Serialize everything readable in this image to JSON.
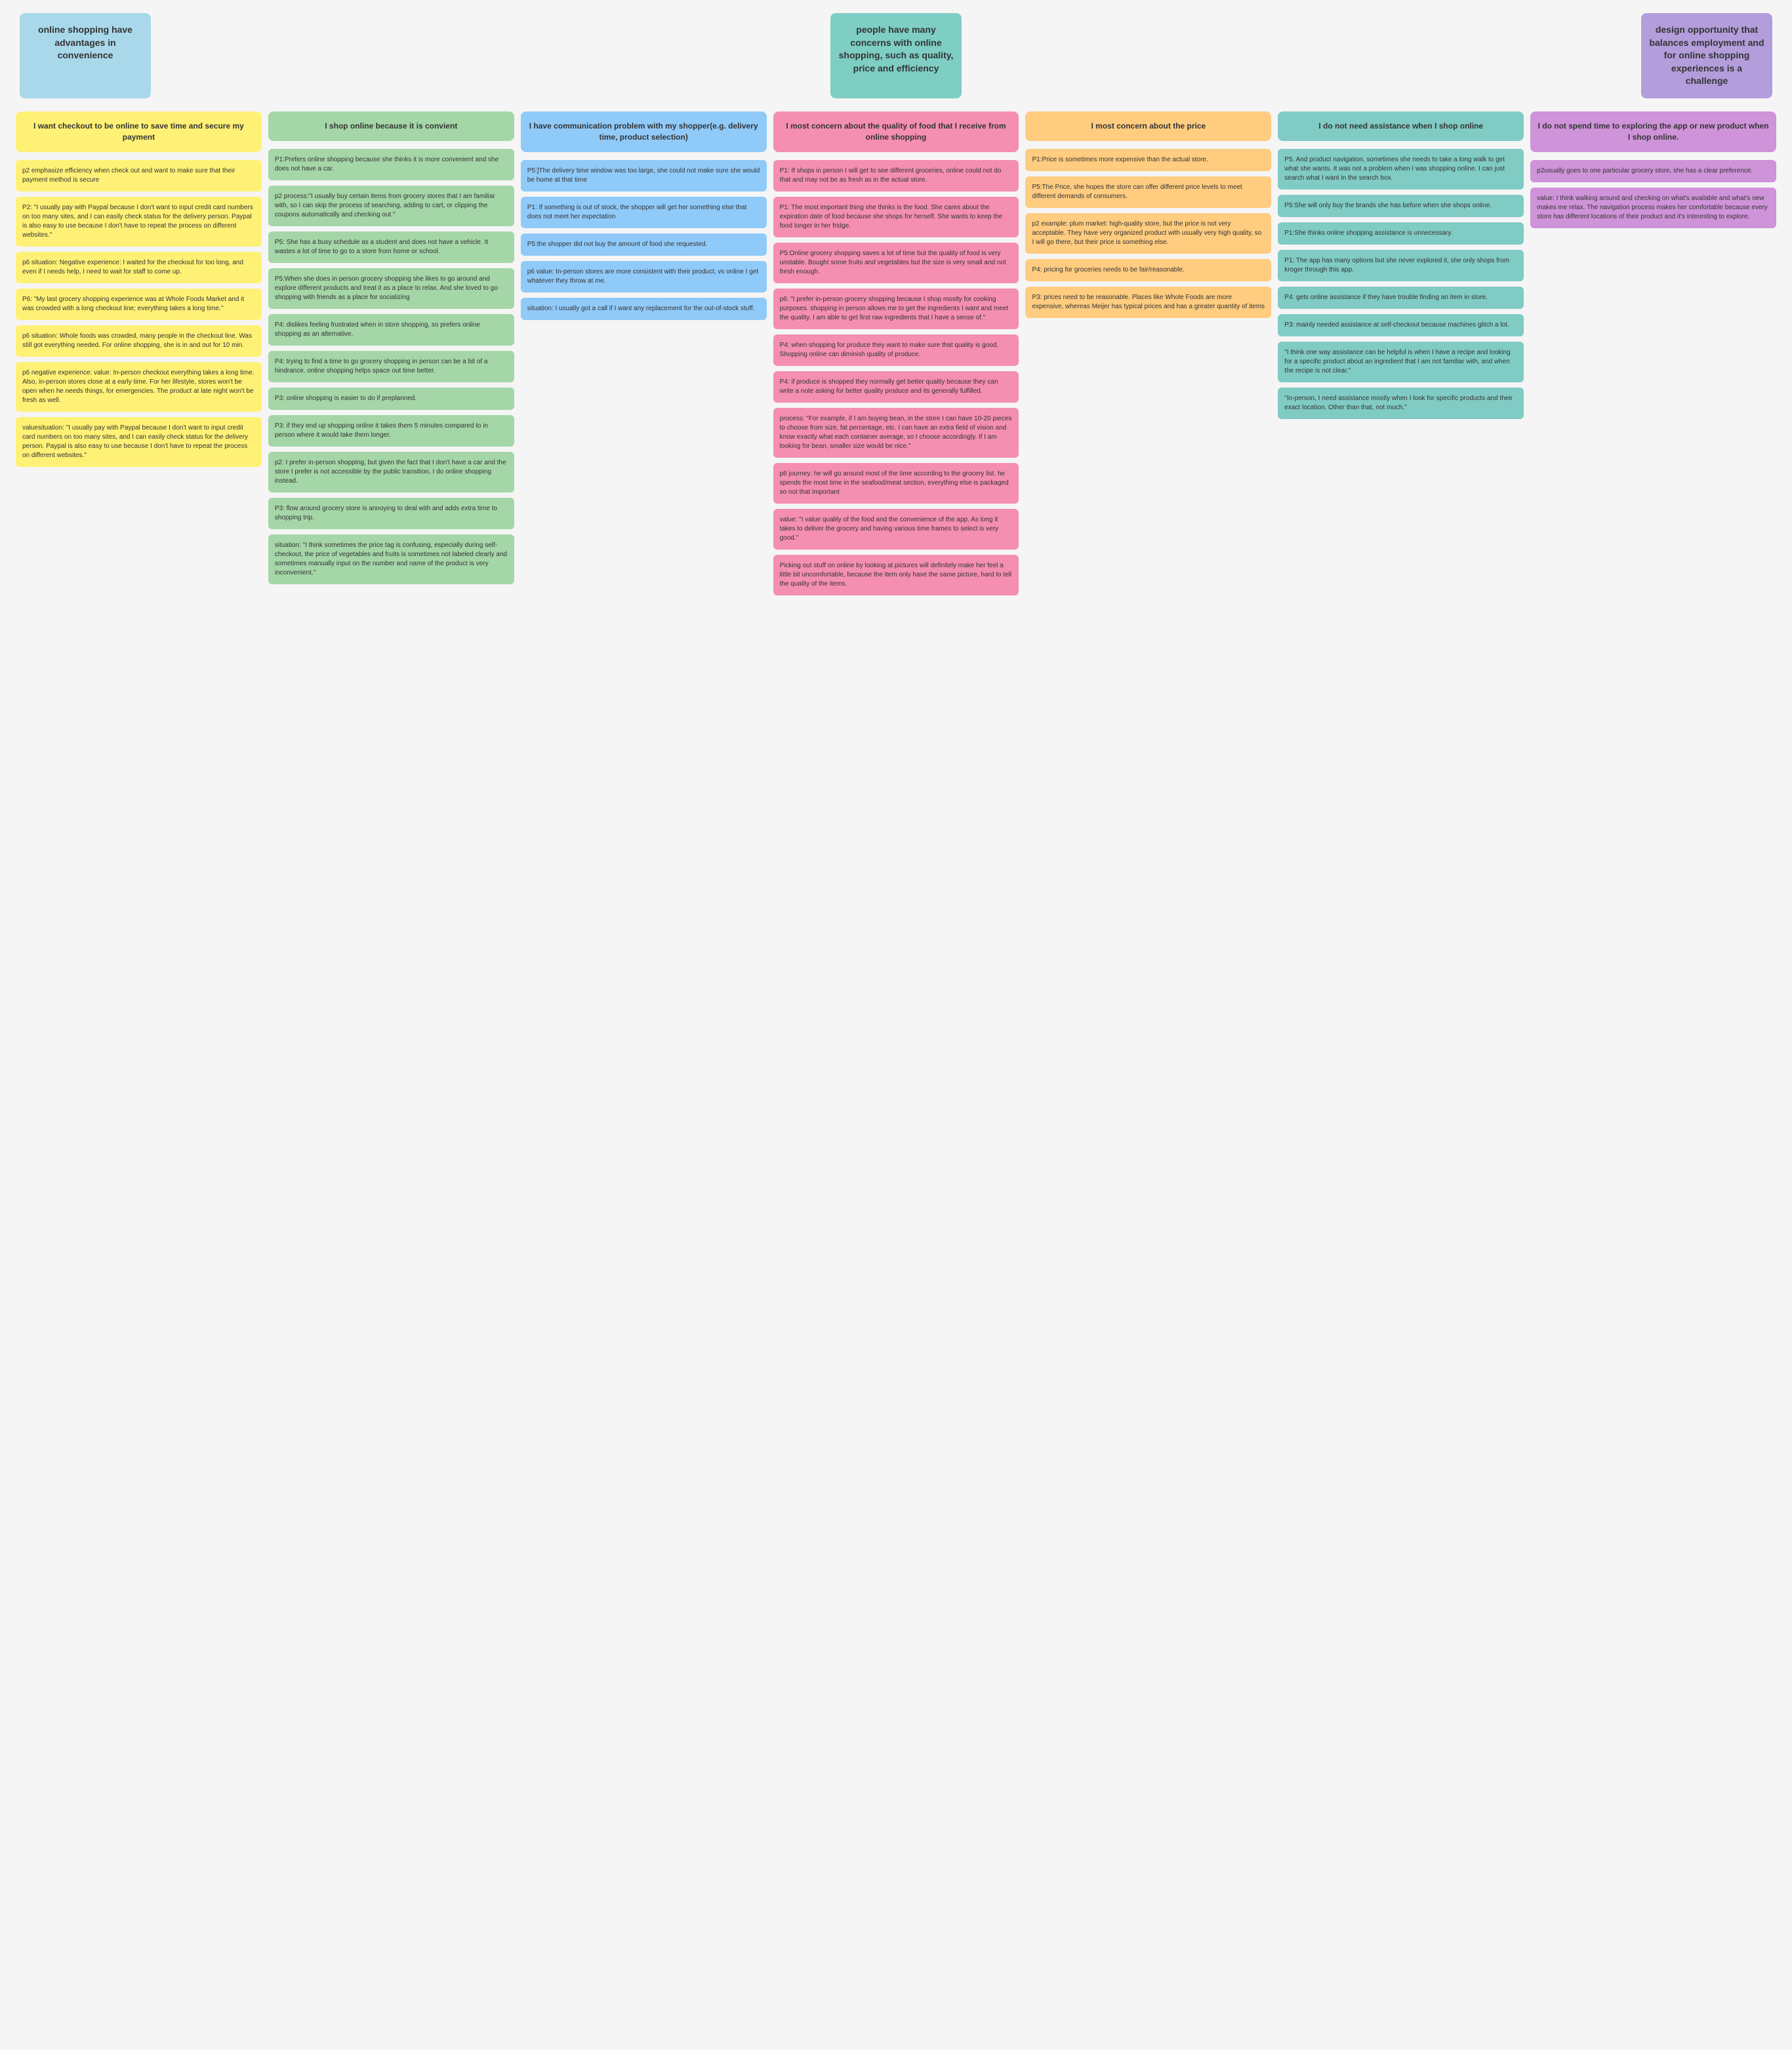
{
  "headers": [
    {
      "id": "h1",
      "text": "online shopping have advantages in convenience",
      "color": "header-blue"
    },
    {
      "id": "h2",
      "text": "people have many concerns with online shopping, such as quality, price and efficiency",
      "color": "header-teal"
    },
    {
      "id": "h3",
      "text": "design opportunity that balances employment and for online shopping experiences is a challenge",
      "color": "header-purple"
    }
  ],
  "columns": [
    {
      "id": "col1",
      "header": {
        "text": "I want checkout to be online to save time and secure my payment",
        "color": "col-header-yellow"
      },
      "notes": [
        {
          "text": "p2 emphasize efficiency when check out and want to make sure that their payment method is secure",
          "color": "note-yellow"
        },
        {
          "text": "P2: \"I usually pay with Paypal because I don't want to input credit card numbers on too many sites, and I can easily check status for the delivery person. Paypal is also easy to use because I don't have to repeat the process on different websites.\"",
          "color": "note-yellow"
        },
        {
          "text": "p6 situation: Negative experience: I waited for the checkout for too long, and even if I needs help, I need to wait for staff to come up.",
          "color": "note-yellow"
        },
        {
          "text": "P6: \"My last grocery shopping experience was at Whole Foods Market and it was crowded with a long checkout line; everything takes a long time.\"",
          "color": "note-yellow"
        },
        {
          "text": "p6 situation: Whole foods was crowded, many people in the checkout line. Was still got everything needed. For online shopping, she is in and out for 10 min.",
          "color": "note-yellow"
        },
        {
          "text": "p6 negative experience: value: In-person checkout everything takes a long time. Also, in-person stores close at a early time. For her lifestyle, stores won't be open when he needs things, for emergencies. The product at late night won't be fresh as well.",
          "color": "note-yellow"
        },
        {
          "text": "valuesituation: \"I usually pay with Paypal because I don't want to input credit card numbers on too many sites, and I can easily check status for the delivery person. Paypal is also easy to use because I don't have to repeat the process on different websites.\"",
          "color": "note-yellow"
        }
      ]
    },
    {
      "id": "col2",
      "header": {
        "text": "I shop online because it is convient",
        "color": "col-header-green"
      },
      "notes": [
        {
          "text": "P1:Prefers online shopping because she thinks it is more convenient and she does not have a car.",
          "color": "note-green"
        },
        {
          "text": "p2 process:\"I usually buy certain items from grocery stores that I am familiar with, so I can skip the process of searching, adding to cart, or clipping the coupons automatically and checking out.\"",
          "color": "note-green"
        },
        {
          "text": "P5: She has a busy schedule as a student and does not have a vehicle. It wastes a lot of time to go to a store from home or school.",
          "color": "note-green"
        },
        {
          "text": "P5:When she does in person grocery shopping she likes to go around and explore different products and treat it as a place to relax. And she loved to go shopping with friends as a place for socializing",
          "color": "note-green"
        },
        {
          "text": "P4: dislikes feeling frustrated when in store shopping, so prefers online shopping as an alternative.",
          "color": "note-green"
        },
        {
          "text": "P4: trying to find a time to go grocery shopping in person can be a bit of a hindrance. online shopping helps space out time better.",
          "color": "note-green"
        },
        {
          "text": "P3: online shopping is easier to do if preplanned.",
          "color": "note-green"
        },
        {
          "text": "P3: if they end up shopping online it takes them 5 minutes compared to in person where it would take them longer.",
          "color": "note-green"
        },
        {
          "text": "p2: I prefer in-person shopping, but given the fact that I don't have a car and the store I prefer is not accessible by the public transition, I do online shopping instead.",
          "color": "note-green"
        },
        {
          "text": "P3: flow around grocery store is annoying to deal with and adds extra time to shopping trip.",
          "color": "note-green"
        },
        {
          "text": "situation: \"I think sometimes the price tag is confusing, especially during self-checkout, the price of vegetables and fruits is sometimes not labeled clearly and sometimes manually input on the number and name of the product is very inconvenient.\"",
          "color": "note-green"
        }
      ]
    },
    {
      "id": "col3",
      "header": {
        "text": "I have communication problem with my shopper(e.g. delivery time, product selection)",
        "color": "col-header-blue"
      },
      "notes": [
        {
          "text": "P5:]The delivery time window was too large, she could not make sure she would be home at that time",
          "color": "note-blue"
        },
        {
          "text": "P1: If something is out of stock, the shopper will get her something else that does not meet her expectation",
          "color": "note-blue"
        },
        {
          "text": "P5:the shopper did not buy the amount of food she requested.",
          "color": "note-blue"
        },
        {
          "text": "p6 value: In-person stores are more consistent with their product, vs online I get whatever they throw at me.",
          "color": "note-blue"
        },
        {
          "text": "situation: I usually got a call if I want any replacement for the out-of-stock stuff.",
          "color": "note-blue"
        }
      ]
    },
    {
      "id": "col4",
      "header": {
        "text": "I most concern about the quality of food that I receive from online shopping",
        "color": "col-header-pink"
      },
      "notes": [
        {
          "text": "P1: If shops in person I will get to see different groceries, online could not do that and may not be as fresh as in the actual store.",
          "color": "note-pink"
        },
        {
          "text": "P1: The most important thing she thinks is the food. She cares about the expiration date of food because she shops for herself. She wants to keep the food longer in her fridge.",
          "color": "note-pink"
        },
        {
          "text": "P5:Online grocery shopping saves a lot of time but the quality of food is very unstable. Bought some fruits and vegetables but the size is very small and not fresh enough.",
          "color": "note-pink"
        },
        {
          "text": "p6: \"I prefer in-person grocery shopping because I shop mostly for cooking purposes. shopping in person allows me to get the ingredients I want and meet the quality. I am able to get first raw ingredients that I have a sense of.\"",
          "color": "note-pink"
        },
        {
          "text": "P4: when shopping for produce they want to make sure that quality is good. Shopping online can diminish quality of produce.",
          "color": "note-pink"
        },
        {
          "text": "P4: if produce is shopped they normally get better quality because they can write a note asking for better quality produce and its generally fulfilled.",
          "color": "note-pink"
        },
        {
          "text": "process: \"For example, if I am buying bean, in the store I can have 10-20 pieces to choose from size, fat percentage, etc. I can have an extra field of vision and know exactly what each container average, so I choose accordingly. If I am looking for bean, smaller size would be nice.\"",
          "color": "note-pink"
        },
        {
          "text": "p6 journey: he will go around most of the time according to the grocery list. he spends the most time in the seafood/meat section, everything else is packaged so not that important",
          "color": "note-pink"
        },
        {
          "text": "value: \"I value quality of the food and the convenience of the app. As long it takes to deliver the grocery and having various time frames to select is very good.\"",
          "color": "note-pink"
        },
        {
          "text": "Picking out stuff on online by looking at pictures will definitely make her feel a little bit uncomfortable, because the item only have the same picture, hard to tell the quality of the items.",
          "color": "note-pink"
        }
      ]
    },
    {
      "id": "col5",
      "header": {
        "text": "I most concern about the price",
        "color": "col-header-orange"
      },
      "notes": [
        {
          "text": "P1:Price is sometimes more expensive than the actual store.",
          "color": "note-orange"
        },
        {
          "text": "P5:The Price, she hopes the store can offer different price levels to meet different demands of consumers.",
          "color": "note-orange"
        },
        {
          "text": "p2 example: plum market: high-quality store, but the price is not very acceptable. They have very organized product with usually very high quality, so I will go there, but their price is something else.",
          "color": "note-orange"
        },
        {
          "text": "P4: pricing for groceries needs to be fair/reasonable.",
          "color": "note-orange"
        },
        {
          "text": "P3: prices need to be reasonable. Places like Whole Foods are more expensive, whereas Meijer has typical prices and has a greater quantity of items",
          "color": "note-orange"
        }
      ]
    },
    {
      "id": "col6",
      "header": {
        "text": "I do not need assistance when I shop online",
        "color": "col-header-teal"
      },
      "notes": [
        {
          "text": "P5. And product navigation, sometimes she needs to take a long walk to get what she wants. It was not a problem when I was shopping online. I can just search what I want in the search box.",
          "color": "note-teal"
        },
        {
          "text": "P5:She will only buy the brands she has before when she shops online.",
          "color": "note-teal"
        },
        {
          "text": "P1:She thinks online shopping assistance is unnecessary.",
          "color": "note-teal"
        },
        {
          "text": "P1: The app has many options but she never explored it, she only shops from kroger through this app.",
          "color": "note-teal"
        },
        {
          "text": "P4: gets online assistance if they have trouble finding an item in store.",
          "color": "note-teal"
        },
        {
          "text": "P3: mainly needed assistance at self-checkout because machines glitch a lot.",
          "color": "note-teal"
        },
        {
          "text": "\"I think one way assistance can be helpful is when I have a recipe and looking for a specific product about an ingredient that I am not familiar with, and when the recipe is not clear.\"",
          "color": "note-teal"
        },
        {
          "text": "\"In-person, I need assistance mostly when I look for specific products and their exact location. Other than that, not much.\"",
          "color": "note-teal"
        }
      ]
    },
    {
      "id": "col7",
      "header": {
        "text": "I do not spend time to exploring the app or new product when I shop online.",
        "color": "col-header-purple"
      },
      "notes": [
        {
          "text": "p2usually goes to one particular grocery store, she has a clear preference.",
          "color": "note-purple"
        },
        {
          "text": "value: I think walking around and checking on what's available and what's new makes me relax. The navigation process makes her comfortable because every store has different locations of their product and it's interesting to explore.",
          "color": "note-purple"
        }
      ]
    }
  ]
}
